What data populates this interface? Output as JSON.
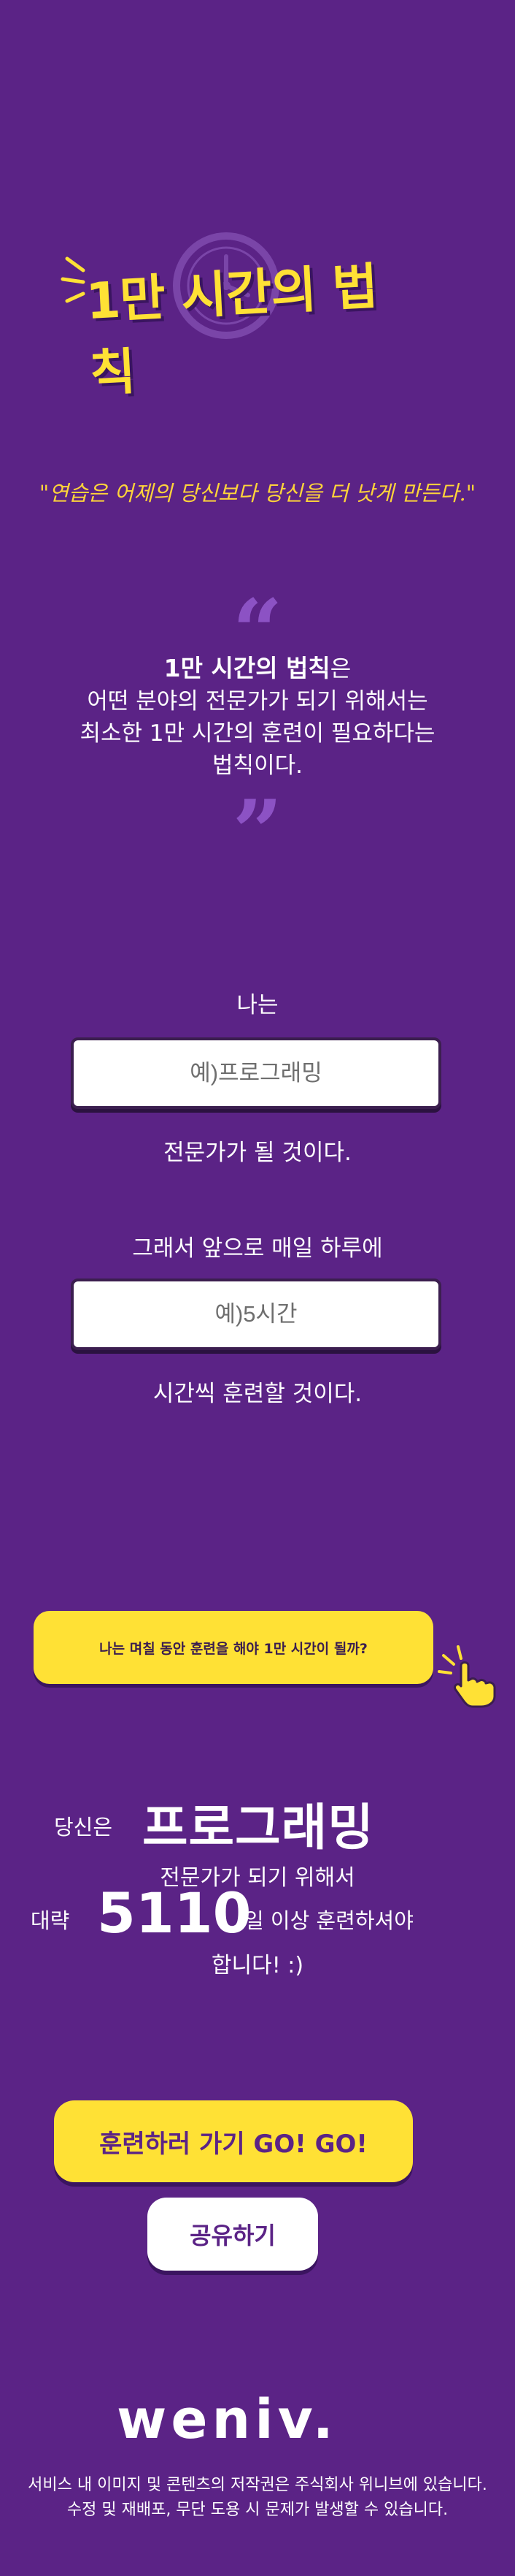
{
  "logo": {
    "text": "1만 시간의 법칙"
  },
  "quote": "\"연습은 어제의 당신보다 당신을 더 낫게 만든다.\"",
  "quote_marks": {
    "open": "“",
    "close": "”"
  },
  "definition": {
    "title": "1만 시간의 법칙",
    "title_suffix": "은",
    "line2": "어떤 분야의 전문가가 되기 위해서는",
    "line3": "최소한 1만 시간의 훈련이 필요하다는",
    "line4": "법칙이다."
  },
  "form": {
    "i_am": "나는",
    "field_placeholder": "예)프로그래밍",
    "will_be": "전문가가 될 것이다.",
    "so_daily": "그래서 앞으로 매일 하루에",
    "time_placeholder": "예)5시간",
    "hours_train": "시간씩 훈련할 것이다."
  },
  "cta": {
    "label": "나는 며칠 동안 훈련을 해야 1만 시간이 될까?"
  },
  "result": {
    "prefix": "당신은",
    "field": "프로그래밍",
    "line2": "전문가가 되기 위해서",
    "about": "대략",
    "days": "5110",
    "suffix": "일 이상 훈련하셔야",
    "end": "합니다! :)"
  },
  "buttons": {
    "go": "훈련하러 가기 GO! GO!",
    "share": "공유하기"
  },
  "footer": {
    "brand": "weniv.",
    "line1": "서비스 내 이미지 및 콘텐츠의 저작권은 주식회사 위니브에 있습니다.",
    "line2": "수정 및 재배포, 무단 도용 시 문제가 발생할 수 있습니다."
  },
  "colors": {
    "background": "#5b2386",
    "accent_yellow": "#ffe135",
    "quote_yellow": "#ffd43a",
    "quote_mark": "#8c52c4"
  },
  "icons": [
    "clock-icon",
    "pointing-hand-icon",
    "quote-open-icon",
    "quote-close-icon"
  ]
}
